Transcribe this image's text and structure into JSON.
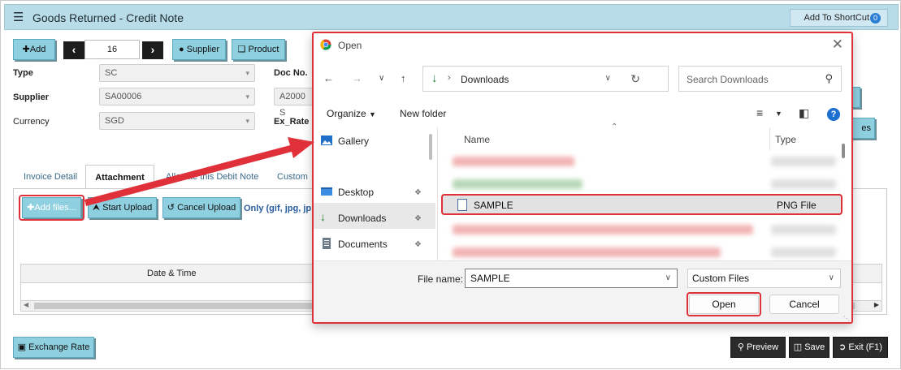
{
  "app": {
    "title": "Goods Returned - Credit Note",
    "add_shortcut_label": "Add To ShortCut",
    "shortcut_count": "0"
  },
  "toolbar": {
    "add_label": "Add",
    "record_number": "16",
    "supplier_label": "Supplier",
    "product_label": "Product"
  },
  "form": {
    "type_label": "Type",
    "type_value": "SC",
    "supplier_label": "Supplier",
    "supplier_value": "SA00006",
    "currency_label": "Currency",
    "currency_value": "SGD",
    "doc_no_label": "Doc No.",
    "doc_no_value": "A2000 S",
    "ex_rate_label": "Ex_Rate",
    "partial_button_text": "es"
  },
  "tabs": [
    {
      "label": "Invoice Detail"
    },
    {
      "label": "Attachment"
    },
    {
      "label": "Allocate this Debit Note"
    },
    {
      "label": "Custom"
    }
  ],
  "attachment": {
    "add_files_label": "Add files...",
    "start_upload_label": "Start Upload",
    "cancel_upload_label": "Cancel Upload",
    "allowed_types_text": "Only (gif, jpg, jp",
    "grid_header_datetime": "Date & Time"
  },
  "footer": {
    "exchange_rate_label": "Exchange Rate",
    "preview_label": "Preview",
    "save_label": "Save",
    "exit_label": "Exit (F1)"
  },
  "dialog": {
    "title": "Open",
    "breadcrumb": "Downloads",
    "search_placeholder": "Search Downloads",
    "organize_label": "Organize",
    "new_folder_label": "New folder",
    "help_label": "?",
    "nav_items": [
      {
        "label": "Gallery"
      },
      {
        "label": "Desktop"
      },
      {
        "label": "Downloads"
      },
      {
        "label": "Documents"
      }
    ],
    "columns": {
      "name": "Name",
      "type": "Type"
    },
    "selected_file": {
      "name": "SAMPLE",
      "type": "PNG File"
    },
    "file_name_label": "File name:",
    "file_name_value": "SAMPLE",
    "file_type_value": "Custom Files",
    "open_label": "Open",
    "cancel_label": "Cancel"
  },
  "colors": {
    "title_bar": "#b9dde8",
    "teal_button": "#8fd0e0",
    "highlight_red": "#e0303a",
    "link_blue": "#2a5d9c"
  }
}
